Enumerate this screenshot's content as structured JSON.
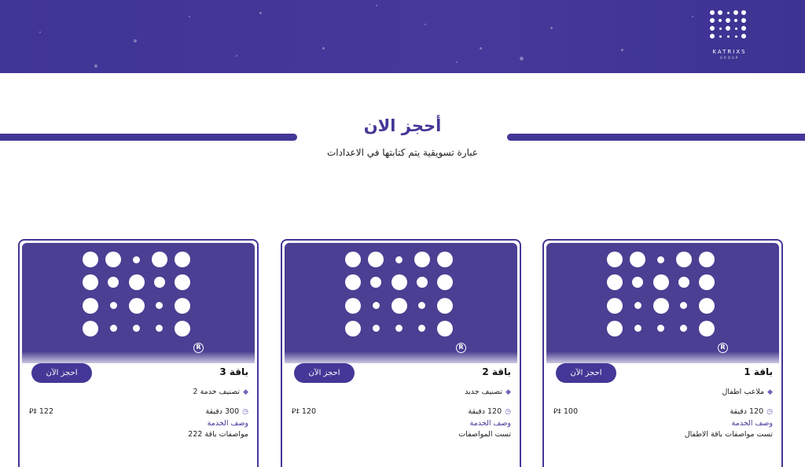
{
  "header": {
    "logo_text": "KATRIXS",
    "logo_sub": "GROUP"
  },
  "hero": {
    "title": "أحجز الان",
    "subtitle": "عبارة تسويقية يتم كتابتها في الاعدادات"
  },
  "colors": {
    "primary": "#433797",
    "card_bg": "#4a3f93"
  },
  "cards": [
    {
      "name": "باقة 1",
      "book_label": "احجز الآن",
      "category": "ملاعب اطفال",
      "duration": "120 دقيقة",
      "price": "100",
      "service_desc_label": "وصف الخدمة",
      "specs": "تست مواصفات باقة الاطفال"
    },
    {
      "name": "باقة 2",
      "book_label": "احجز الآن",
      "category": "تصنيف جديد",
      "duration": "120 دقيقة",
      "price": "120",
      "service_desc_label": "وصف الخدمة",
      "specs": "تست المواصفات"
    },
    {
      "name": "باقة 3",
      "book_label": "احجز الآن",
      "category": "تصنيف خدمة 2",
      "duration": "300 دقيقة",
      "price": "122",
      "service_desc_label": "وصف الخدمة",
      "specs": "مواصفات باقة 222"
    }
  ],
  "icons": {
    "category": "pin-icon",
    "duration": "clock-icon",
    "currency": "riyal-icon",
    "registered": "registered-icon"
  }
}
